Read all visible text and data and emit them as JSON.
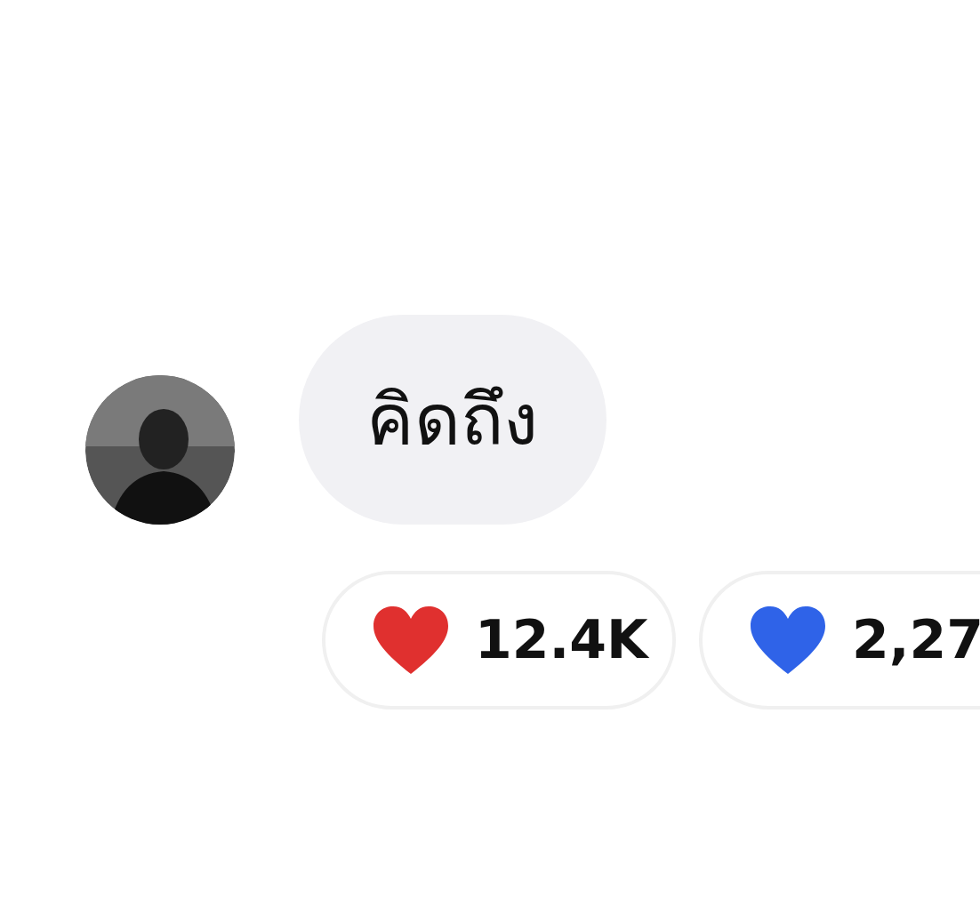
{
  "message": {
    "text": "คิดถึง"
  },
  "reactions": [
    {
      "color": "#e0302f",
      "count": "12.4K"
    },
    {
      "color": "#2f63e8",
      "count": "2,27"
    }
  ]
}
